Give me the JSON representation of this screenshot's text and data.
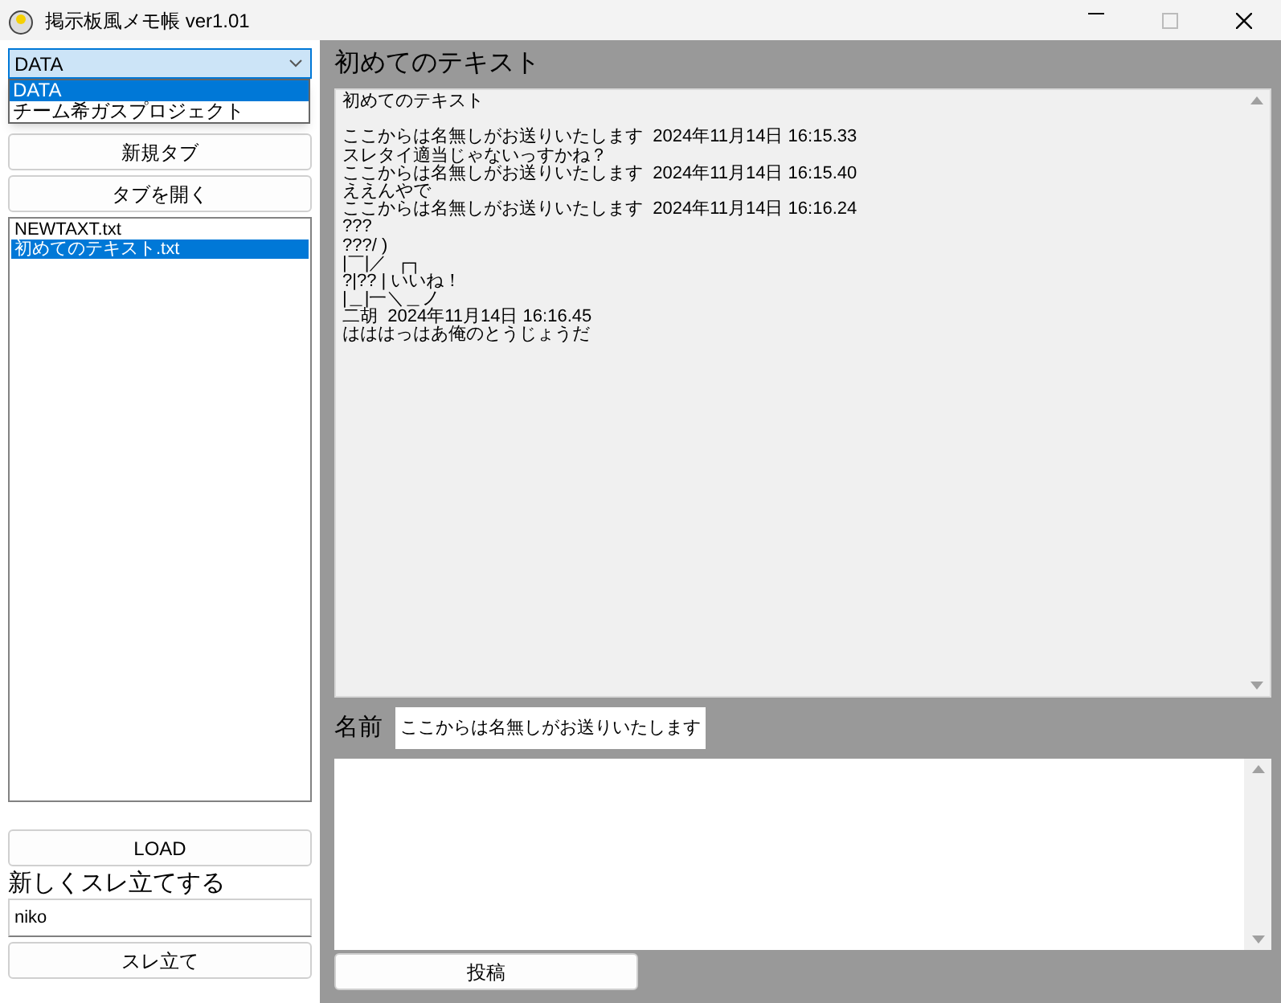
{
  "window": {
    "title": "掲示板風メモ帳 ver1.01"
  },
  "board_select": {
    "value": "DATA",
    "options": [
      {
        "label": "DATA",
        "selected": true
      },
      {
        "label": "チーム希ガスプロジェクト",
        "selected": false
      }
    ]
  },
  "buttons": {
    "new_tab": "新規タブ",
    "open_tab": "タブを開く",
    "load": "LOAD",
    "create_thread": "スレ立て",
    "post": "投稿"
  },
  "files": [
    {
      "label": "NEWTAXT.txt",
      "selected": false
    },
    {
      "label": "初めてのテキスト.txt",
      "selected": true
    }
  ],
  "new_thread": {
    "label": "新しくスレ立てする",
    "value": "niko"
  },
  "thread": {
    "title": "初めてのテキスト",
    "first_line": "初めてのテキスト",
    "lines": [
      "ここからは名無しがお送りいたします  2024年11月14日 16:15.33",
      "スレタイ適当じゃないっすかね？",
      "ここからは名無しがお送りいたします  2024年11月14日 16:15.40",
      "ええんやで",
      "ここからは名無しがお送りいたします  2024年11月14日 16:16.24",
      "???",
      "???/ )",
      "|￣|／  ┌┐",
      "?|?? | いいね！",
      "|＿|一＼＿ノ",
      "二胡  2024年11月14日 16:16.45",
      "はははっはあ俺のとうじょうだ"
    ]
  },
  "name_field": {
    "label": "名前",
    "value": "ここからは名無しがお送りいたします"
  }
}
